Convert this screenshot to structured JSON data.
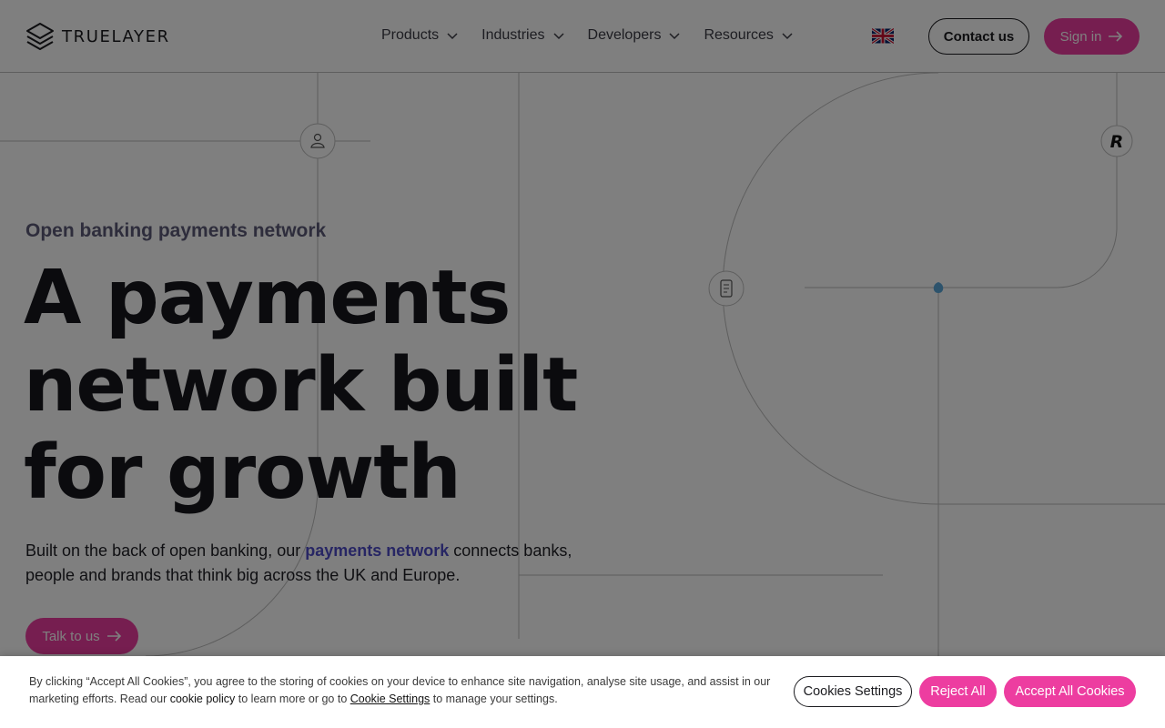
{
  "header": {
    "logo_text": "TRUELAYER",
    "nav": [
      {
        "label": "Products"
      },
      {
        "label": "Industries"
      },
      {
        "label": "Developers"
      },
      {
        "label": "Resources"
      }
    ],
    "language_flag": "uk-flag-icon",
    "contact_label": "Contact us",
    "signin_label": "Sign in"
  },
  "hero": {
    "eyebrow": "Open banking payments network",
    "headline": [
      "A payments",
      "network built",
      "for growth"
    ],
    "body_before": "Built on the back of open banking, our ",
    "body_link": "payments network",
    "body_after": " connects banks, people and brands that think big across the UK and Europe.",
    "cta_label": "Talk to us"
  },
  "diagram_icons": [
    "person-icon",
    "receipt-icon",
    "revolut-icon",
    "tree-icon"
  ],
  "cookie_banner": {
    "text_1": "By clicking “Accept All Cookies”, you agree to the storing of cookies on your device to enhance site navigation, analyse site usage, and assist in our marketing efforts. Read our ",
    "cookie_policy_link": "cookie policy",
    "text_2": " to learn more or go to ",
    "cookie_settings_link": "Cookie Settings",
    "text_3": " to manage your settings.",
    "settings_label": "Cookies Settings",
    "reject_label": "Reject All",
    "accept_label": "Accept All Cookies"
  },
  "colors": {
    "brand_pink": "#ed3da0",
    "link_purple": "#4f4cc9",
    "text_dark": "#16161c"
  }
}
